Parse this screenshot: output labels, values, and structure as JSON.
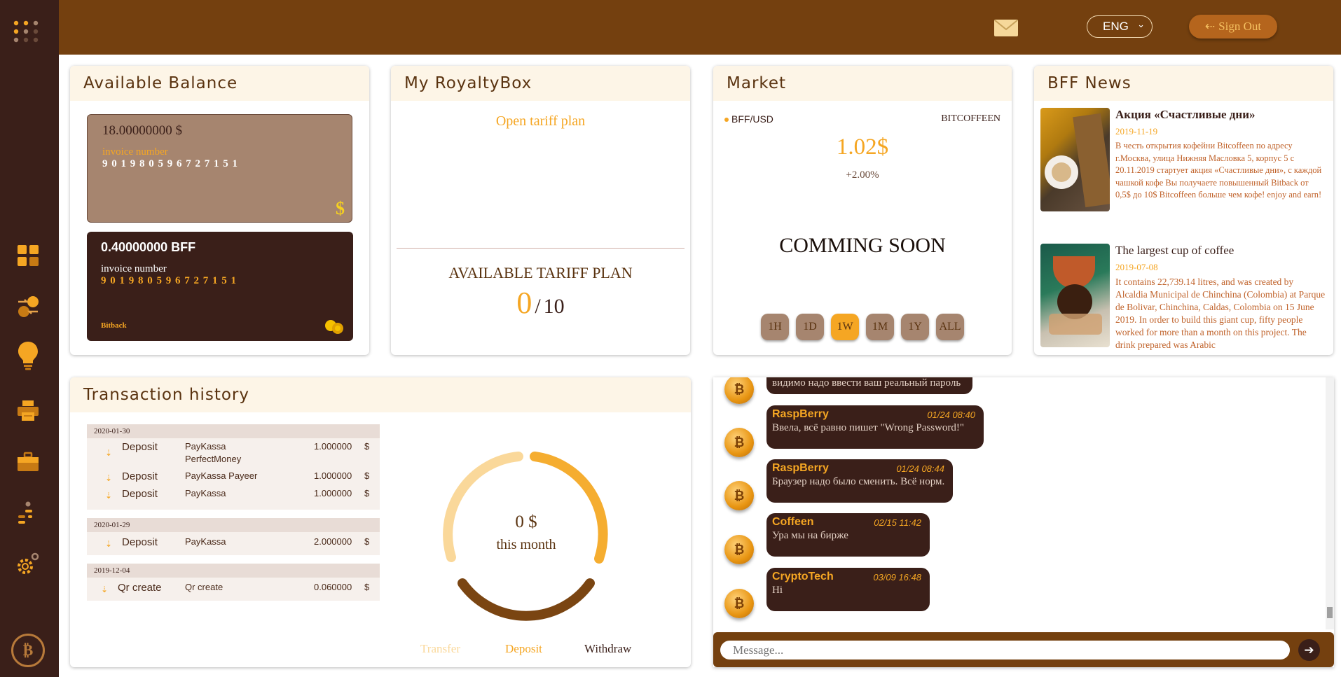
{
  "header": {
    "language": "ENG",
    "signout_label": "Sign Out"
  },
  "sidebar": {
    "items": [
      {
        "icon": "dashboard-icon"
      },
      {
        "icon": "exchange-icon"
      },
      {
        "icon": "lightbulb-icon"
      },
      {
        "icon": "printer-icon"
      },
      {
        "icon": "briefcase-icon"
      },
      {
        "icon": "steps-icon"
      },
      {
        "icon": "settings-icon"
      }
    ]
  },
  "balance": {
    "title": "Available Balance",
    "usd_amount": "18.00000000 $",
    "usd_invoice_label": "invoice number",
    "usd_invoice_number": "9 0 1 9 8 0 5 9 6 7 2 7 1 5 1",
    "usd_symbol": "$",
    "bff_amount": "0.40000000 BFF",
    "bff_invoice_label": "invoice number",
    "bff_invoice_number": "9 0 1 9 8 0 5 9 6 7 2 7 1 5 1",
    "bff_brand": "Bitback"
  },
  "royalty": {
    "title": "My RoyaltyBox",
    "open_plan": "Open tariff plan",
    "available_label": "AVAILABLE TARIFF PLAN",
    "count": "0",
    "separator": "/",
    "total": "10"
  },
  "market": {
    "title": "Market",
    "pair": "BFF/USD",
    "coin": "BITCOFFEEN",
    "price": "1.02$",
    "change": "+2.00%",
    "notice": "COMMING SOON",
    "timeframes": [
      "1H",
      "1D",
      "1W",
      "1M",
      "1Y",
      "ALL"
    ],
    "active_timeframe": "1W"
  },
  "news": {
    "title": "BFF News",
    "items": [
      {
        "title": "Акция «Счастливые дни»",
        "date": "2019-11-19",
        "body": "В честь открытия кофейни Bitcoffeen по адресу г.Москва, улица Нижняя Масловка 5, корпус 5 с 20.11.2019 стартует акция «Счастливые дни», с каждой чашкой кофе Вы получаете повышенный Bitback от 0,5$ до 10$ Bitcoffeen больше чем кофе! enjoy and earn!"
      },
      {
        "title": "The largest cup of coffee",
        "date": "2019-07-08",
        "body": "It contains 22,739.14 litres, and was created by Alcaldia Municipal de Chinchina (Colombia) at Parque de Bolivar, Chinchina, Caldas, Colombia on 15 June 2019. In order to build this giant cup, fifty people worked for more than a month on this project. The drink prepared was Arabic"
      }
    ]
  },
  "transactions": {
    "title": "Transaction history",
    "groups": [
      {
        "date": "2020-01-30",
        "rows": [
          {
            "type": "Deposit",
            "method": "PayKassa",
            "method2": "PerfectMoney",
            "amount": "1.000000",
            "currency": "$"
          },
          {
            "type": "Deposit",
            "method": "PayKassa Payeer",
            "amount": "1.000000",
            "currency": "$"
          },
          {
            "type": "Deposit",
            "method": "PayKassa",
            "amount": "1.000000",
            "currency": "$"
          }
        ]
      },
      {
        "date": "2020-01-29",
        "rows": [
          {
            "type": "Deposit",
            "method": "PayKassa",
            "amount": "2.000000",
            "currency": "$"
          }
        ]
      },
      {
        "date": "2019-12-04",
        "rows": [
          {
            "type": "Qr create",
            "method": "Qr create",
            "amount": "0.060000",
            "currency": "$"
          }
        ]
      }
    ],
    "donut_amount": "0 $",
    "donut_label": "this month",
    "actions": {
      "transfer": "Transfer",
      "deposit": "Deposit",
      "withdraw": "Withdraw"
    }
  },
  "chat": {
    "clipped_text": "видимо надо ввести ваш реальный пароль",
    "messages": [
      {
        "name": "RaspBerry",
        "time": "01/24 08:40",
        "text": "Ввела, всё равно пишет \"Wrong Password!\""
      },
      {
        "name": "RaspBerry",
        "time": "01/24 08:44",
        "text": "Браузер надо было сменить. Всё норм."
      },
      {
        "name": "Coffeen",
        "time": "02/15 11:42",
        "text": "Ура мы на бирже"
      },
      {
        "name": "CryptoTech",
        "time": "03/09 16:48",
        "text": "Hi"
      }
    ],
    "placeholder": "Message..."
  },
  "colors": {
    "sidebar": "#3a1f19",
    "header": "#74400f",
    "accent": "#f5a623",
    "card_header": "#fdf5e7"
  }
}
